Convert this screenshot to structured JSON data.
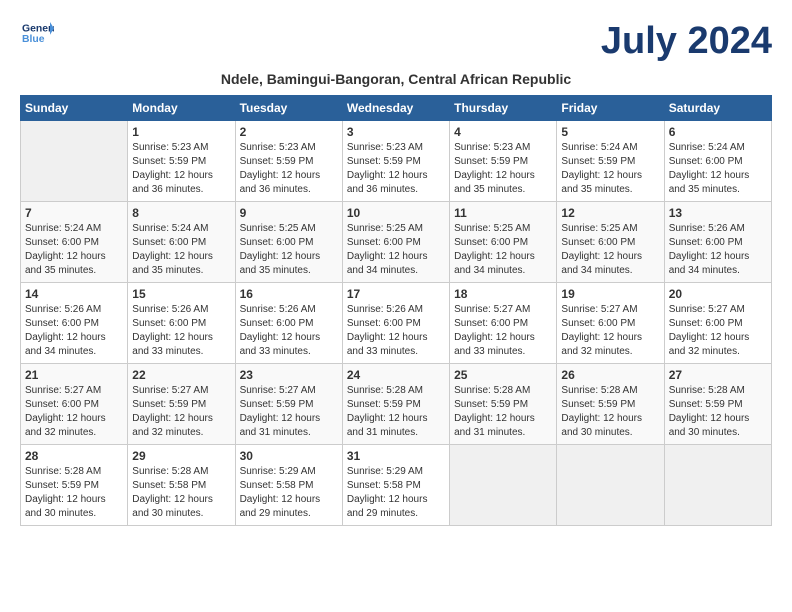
{
  "header": {
    "logo_line1": "General",
    "logo_line2": "Blue",
    "month": "July 2024",
    "location": "Ndele, Bamingui-Bangoran, Central African Republic"
  },
  "weekdays": [
    "Sunday",
    "Monday",
    "Tuesday",
    "Wednesday",
    "Thursday",
    "Friday",
    "Saturday"
  ],
  "weeks": [
    [
      {
        "day": "",
        "info": ""
      },
      {
        "day": "1",
        "info": "Sunrise: 5:23 AM\nSunset: 5:59 PM\nDaylight: 12 hours\nand 36 minutes."
      },
      {
        "day": "2",
        "info": "Sunrise: 5:23 AM\nSunset: 5:59 PM\nDaylight: 12 hours\nand 36 minutes."
      },
      {
        "day": "3",
        "info": "Sunrise: 5:23 AM\nSunset: 5:59 PM\nDaylight: 12 hours\nand 36 minutes."
      },
      {
        "day": "4",
        "info": "Sunrise: 5:23 AM\nSunset: 5:59 PM\nDaylight: 12 hours\nand 35 minutes."
      },
      {
        "day": "5",
        "info": "Sunrise: 5:24 AM\nSunset: 5:59 PM\nDaylight: 12 hours\nand 35 minutes."
      },
      {
        "day": "6",
        "info": "Sunrise: 5:24 AM\nSunset: 6:00 PM\nDaylight: 12 hours\nand 35 minutes."
      }
    ],
    [
      {
        "day": "7",
        "info": "Sunrise: 5:24 AM\nSunset: 6:00 PM\nDaylight: 12 hours\nand 35 minutes."
      },
      {
        "day": "8",
        "info": "Sunrise: 5:24 AM\nSunset: 6:00 PM\nDaylight: 12 hours\nand 35 minutes."
      },
      {
        "day": "9",
        "info": "Sunrise: 5:25 AM\nSunset: 6:00 PM\nDaylight: 12 hours\nand 35 minutes."
      },
      {
        "day": "10",
        "info": "Sunrise: 5:25 AM\nSunset: 6:00 PM\nDaylight: 12 hours\nand 34 minutes."
      },
      {
        "day": "11",
        "info": "Sunrise: 5:25 AM\nSunset: 6:00 PM\nDaylight: 12 hours\nand 34 minutes."
      },
      {
        "day": "12",
        "info": "Sunrise: 5:25 AM\nSunset: 6:00 PM\nDaylight: 12 hours\nand 34 minutes."
      },
      {
        "day": "13",
        "info": "Sunrise: 5:26 AM\nSunset: 6:00 PM\nDaylight: 12 hours\nand 34 minutes."
      }
    ],
    [
      {
        "day": "14",
        "info": "Sunrise: 5:26 AM\nSunset: 6:00 PM\nDaylight: 12 hours\nand 34 minutes."
      },
      {
        "day": "15",
        "info": "Sunrise: 5:26 AM\nSunset: 6:00 PM\nDaylight: 12 hours\nand 33 minutes."
      },
      {
        "day": "16",
        "info": "Sunrise: 5:26 AM\nSunset: 6:00 PM\nDaylight: 12 hours\nand 33 minutes."
      },
      {
        "day": "17",
        "info": "Sunrise: 5:26 AM\nSunset: 6:00 PM\nDaylight: 12 hours\nand 33 minutes."
      },
      {
        "day": "18",
        "info": "Sunrise: 5:27 AM\nSunset: 6:00 PM\nDaylight: 12 hours\nand 33 minutes."
      },
      {
        "day": "19",
        "info": "Sunrise: 5:27 AM\nSunset: 6:00 PM\nDaylight: 12 hours\nand 32 minutes."
      },
      {
        "day": "20",
        "info": "Sunrise: 5:27 AM\nSunset: 6:00 PM\nDaylight: 12 hours\nand 32 minutes."
      }
    ],
    [
      {
        "day": "21",
        "info": "Sunrise: 5:27 AM\nSunset: 6:00 PM\nDaylight: 12 hours\nand 32 minutes."
      },
      {
        "day": "22",
        "info": "Sunrise: 5:27 AM\nSunset: 5:59 PM\nDaylight: 12 hours\nand 32 minutes."
      },
      {
        "day": "23",
        "info": "Sunrise: 5:27 AM\nSunset: 5:59 PM\nDaylight: 12 hours\nand 31 minutes."
      },
      {
        "day": "24",
        "info": "Sunrise: 5:28 AM\nSunset: 5:59 PM\nDaylight: 12 hours\nand 31 minutes."
      },
      {
        "day": "25",
        "info": "Sunrise: 5:28 AM\nSunset: 5:59 PM\nDaylight: 12 hours\nand 31 minutes."
      },
      {
        "day": "26",
        "info": "Sunrise: 5:28 AM\nSunset: 5:59 PM\nDaylight: 12 hours\nand 30 minutes."
      },
      {
        "day": "27",
        "info": "Sunrise: 5:28 AM\nSunset: 5:59 PM\nDaylight: 12 hours\nand 30 minutes."
      }
    ],
    [
      {
        "day": "28",
        "info": "Sunrise: 5:28 AM\nSunset: 5:59 PM\nDaylight: 12 hours\nand 30 minutes."
      },
      {
        "day": "29",
        "info": "Sunrise: 5:28 AM\nSunset: 5:58 PM\nDaylight: 12 hours\nand 30 minutes."
      },
      {
        "day": "30",
        "info": "Sunrise: 5:29 AM\nSunset: 5:58 PM\nDaylight: 12 hours\nand 29 minutes."
      },
      {
        "day": "31",
        "info": "Sunrise: 5:29 AM\nSunset: 5:58 PM\nDaylight: 12 hours\nand 29 minutes."
      },
      {
        "day": "",
        "info": ""
      },
      {
        "day": "",
        "info": ""
      },
      {
        "day": "",
        "info": ""
      }
    ]
  ]
}
